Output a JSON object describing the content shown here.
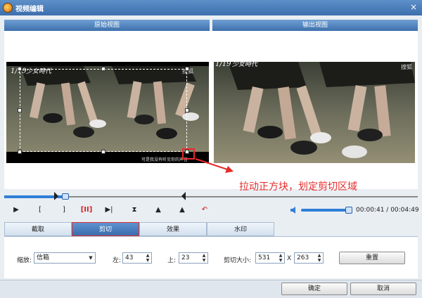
{
  "window": {
    "title": "视频编辑",
    "close_label": "×"
  },
  "views": {
    "original_label": "原始视图",
    "output_label": "输出视图"
  },
  "preview": {
    "overlay_date": "1/19",
    "overlay_title": "少女時代",
    "overlay_corner": "搜狐",
    "subtitle": "可是我没有听见你的声音"
  },
  "callout": {
    "text": "拉动正方块，划定剪切区域",
    "color": "#e52b2b"
  },
  "seek": {
    "progress": 0.148
  },
  "controls": {
    "play": "▶",
    "mark_in": "[",
    "mark_out": "]",
    "clip": "[II]",
    "next": "▶|",
    "to_start": "⧗",
    "rotate_left": "▲",
    "rotate_right": "▲",
    "undo": "↶"
  },
  "volume": {
    "level": 1.0
  },
  "time": {
    "current": "00:00:41",
    "separator": " / ",
    "total": "00:04:49"
  },
  "tabs": [
    {
      "label": "截取"
    },
    {
      "label": "剪切"
    },
    {
      "label": "效果"
    },
    {
      "label": "水印"
    }
  ],
  "crop": {
    "zoom_label": "缩放:",
    "zoom_value": "信箱",
    "left_label": "左:",
    "left_value": "43",
    "top_label": "上:",
    "top_value": "23",
    "size_label": "剪切大小:",
    "width_value": "531",
    "x_label": "X",
    "height_value": "263",
    "reset_label": "重置"
  },
  "footer": {
    "ok_label": "确定",
    "cancel_label": "取消"
  },
  "colors": {
    "accent": "#3d6fae",
    "highlight": "#e03030"
  }
}
